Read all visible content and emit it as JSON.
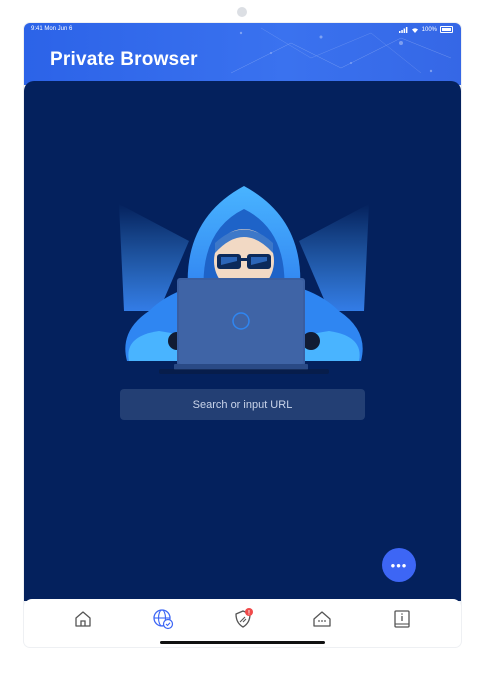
{
  "status_bar": {
    "time_date": "9:41  Mon Jun 6",
    "battery": "100%"
  },
  "header": {
    "title": "Private Browser"
  },
  "search": {
    "placeholder": "Search or input URL"
  },
  "fab": {
    "label": "•••"
  },
  "tabbar": {
    "items": [
      {
        "icon": "home-icon"
      },
      {
        "icon": "globe-shield-icon",
        "active": true
      },
      {
        "icon": "shield-badge-icon",
        "badge": "!"
      },
      {
        "icon": "house-dots-icon"
      },
      {
        "icon": "info-book-icon"
      }
    ]
  },
  "colors": {
    "header_blue": "#3068ea",
    "main_bg": "#04215d",
    "accent": "#3d66f5",
    "badge_red": "#f04a4a"
  }
}
